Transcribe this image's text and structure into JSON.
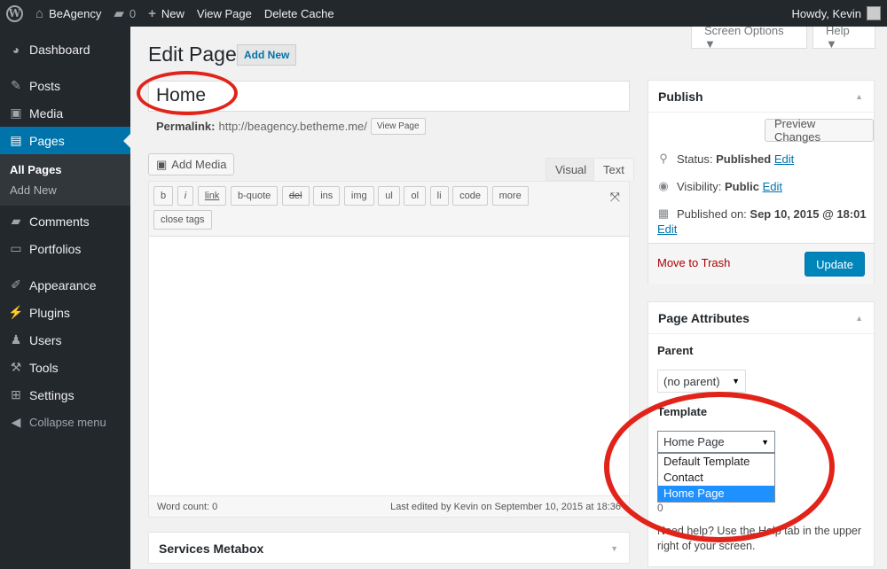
{
  "adminbar": {
    "site_name": "BeAgency",
    "comments_count": "0",
    "new_label": "New",
    "view_page": "View Page",
    "delete_cache": "Delete Cache",
    "howdy": "Howdy, Kevin"
  },
  "sidebar": {
    "items": [
      {
        "label": "Dashboard",
        "icon": "dashboard-icon"
      },
      {
        "label": "Posts",
        "icon": "pin-icon"
      },
      {
        "label": "Media",
        "icon": "media-icon"
      },
      {
        "label": "Pages",
        "icon": "pages-icon"
      },
      {
        "label": "Comments",
        "icon": "comment-icon"
      },
      {
        "label": "Portfolios",
        "icon": "folder-icon"
      },
      {
        "label": "Appearance",
        "icon": "brush-icon"
      },
      {
        "label": "Plugins",
        "icon": "plugin-icon"
      },
      {
        "label": "Users",
        "icon": "user-icon"
      },
      {
        "label": "Tools",
        "icon": "wrench-icon"
      },
      {
        "label": "Settings",
        "icon": "settings-icon"
      }
    ],
    "submenu": [
      "All Pages",
      "Add New"
    ],
    "collapse": "Collapse menu"
  },
  "header": {
    "screen_options": "Screen Options ▼",
    "help": "Help ▼",
    "title": "Edit Page",
    "add_new": "Add New"
  },
  "editor": {
    "post_title": "Home",
    "permalink_label": "Permalink:",
    "permalink_url": "http://beagency.betheme.me/",
    "view_page": "View Page",
    "add_media": "Add Media",
    "tab_visual": "Visual",
    "tab_text": "Text",
    "quicktags": [
      "b",
      "i",
      "link",
      "b-quote",
      "del",
      "ins",
      "img",
      "ul",
      "ol",
      "li",
      "code",
      "more"
    ],
    "close_tags": "close tags",
    "word_count": "Word count: 0",
    "last_edited": "Last edited by Kevin on September 10, 2015 at 18:36"
  },
  "services_metabox": {
    "title": "Services Metabox"
  },
  "publish": {
    "title": "Publish",
    "preview": "Preview Changes",
    "status_label": "Status:",
    "status_value": "Published",
    "visibility_label": "Visibility:",
    "visibility_value": "Public",
    "published_label": "Published on:",
    "published_value": "Sep 10, 2015 @ 18:01",
    "edit": "Edit",
    "trash": "Move to Trash",
    "update": "Update"
  },
  "page_attributes": {
    "title": "Page Attributes",
    "parent_label": "Parent",
    "parent_value": "(no parent)",
    "template_label": "Template",
    "template_value": "Home Page",
    "template_options": [
      "Default Template",
      "Contact",
      "Home Page"
    ],
    "order_partial": "0",
    "help": "Need help? Use the Help tab in the upper right of your screen."
  },
  "colors": {
    "admin_bar": "#23282d",
    "accent": "#0073aa",
    "primary_button": "#0085ba",
    "annotation_red": "#e2231a"
  }
}
